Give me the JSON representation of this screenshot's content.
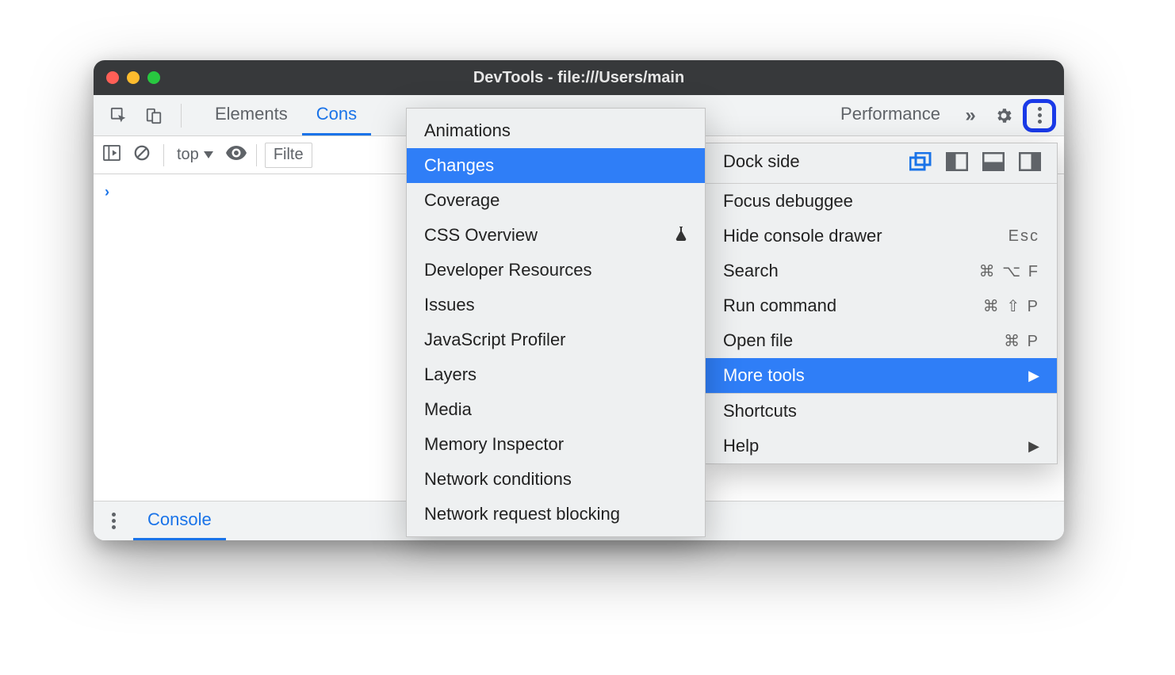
{
  "window": {
    "title": "DevTools - file:///Users/main"
  },
  "tabs": {
    "elements": "Elements",
    "console": "Cons",
    "performance": "Performance"
  },
  "toolbar": {
    "context": "top",
    "filter_placeholder": "Filte"
  },
  "drawer": {
    "console": "Console"
  },
  "mainmenu": {
    "dockside": "Dock side",
    "focus": "Focus debuggee",
    "hide_drawer": "Hide console drawer",
    "hide_drawer_sc": "Esc",
    "search": "Search",
    "search_sc": "⌘ ⌥ F",
    "run": "Run command",
    "run_sc": "⌘ ⇧ P",
    "open": "Open file",
    "open_sc": "⌘ P",
    "moretools": "More tools",
    "shortcuts": "Shortcuts",
    "help": "Help"
  },
  "submenu": {
    "items": [
      "Animations",
      "Changes",
      "Coverage",
      "CSS Overview",
      "Developer Resources",
      "Issues",
      "JavaScript Profiler",
      "Layers",
      "Media",
      "Memory Inspector",
      "Network conditions",
      "Network request blocking"
    ],
    "highlight_index": 1,
    "flask_index": 3
  }
}
